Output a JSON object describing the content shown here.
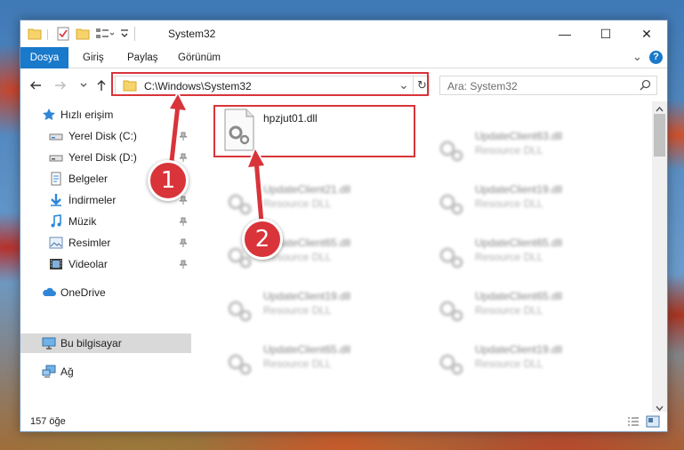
{
  "window": {
    "title": "System32",
    "minimize": "—",
    "maximize": "☐",
    "close": "✕"
  },
  "ribbon": {
    "tabs": [
      "Dosya",
      "Giriş",
      "Paylaş",
      "Görünüm"
    ],
    "expand": "⌄",
    "help": "?"
  },
  "address": {
    "path": "C:\\Windows\\System32",
    "dropdown": "⌄",
    "refresh": "↻"
  },
  "search": {
    "placeholder": "Ara: System32"
  },
  "nav": {
    "quick_access": "Hızlı erişim",
    "items": [
      {
        "label": "Yerel Disk (C:)"
      },
      {
        "label": "Yerel Disk (D:)"
      },
      {
        "label": "Belgeler"
      },
      {
        "label": "İndirmeler"
      },
      {
        "label": "Müzik"
      },
      {
        "label": "Resimler"
      },
      {
        "label": "Videolar"
      }
    ],
    "onedrive": "OneDrive",
    "this_pc": "Bu bilgisayar",
    "network": "Ağ"
  },
  "files": {
    "highlighted": {
      "name": "hpzjut01.dll"
    },
    "left_column": [
      {
        "name": "UpdateClient21.dll",
        "type": "Resource DLL"
      },
      {
        "name": "UpdateClient65.dll",
        "type": "Resource DLL"
      },
      {
        "name": "UpdateClient19.dll",
        "type": "Resource DLL"
      },
      {
        "name": "UpdateClient65.dll",
        "type": "Resource DLL"
      }
    ],
    "right_column": [
      {
        "name": "UpdateClient63.dll",
        "type": "Resource DLL"
      },
      {
        "name": "UpdateClient19.dll",
        "type": "Resource DLL"
      },
      {
        "name": "UpdateClient65.dll",
        "type": "Resource DLL"
      },
      {
        "name": "UpdateClient65.dll",
        "type": "Resource DLL"
      },
      {
        "name": "UpdateClient19.dll",
        "type": "Resource DLL"
      }
    ]
  },
  "status": {
    "count": "157 öğe"
  },
  "callouts": [
    "1",
    "2"
  ],
  "colors": {
    "accent": "#1979ca",
    "highlight": "#d8343a",
    "selected": "#d9d9d9"
  }
}
